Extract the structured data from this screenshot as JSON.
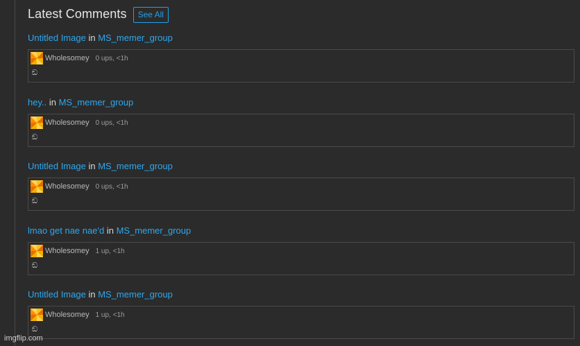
{
  "header": {
    "title": "Latest Comments",
    "see_all_label": "See All"
  },
  "comments": [
    {
      "post_title": "Untitled Image",
      "in_word": "in",
      "group_name": "MS_memer_group",
      "username": "Wholesomey",
      "stats": "0 ups, <1h",
      "text": "ඞ"
    },
    {
      "post_title": "hey..",
      "in_word": "in",
      "group_name": "MS_memer_group",
      "username": "Wholesomey",
      "stats": "0 ups, <1h",
      "text": "ඞ"
    },
    {
      "post_title": "Untitled Image",
      "in_word": "in",
      "group_name": "MS_memer_group",
      "username": "Wholesomey",
      "stats": "0 ups, <1h",
      "text": "ඞ"
    },
    {
      "post_title": "lmao get nae nae'd",
      "in_word": "in",
      "group_name": "MS_memer_group",
      "username": "Wholesomey",
      "stats": "1 up, <1h",
      "text": "ඞ"
    },
    {
      "post_title": "Untitled Image",
      "in_word": "in",
      "group_name": "MS_memer_group",
      "username": "Wholesomey",
      "stats": "1 up, <1h",
      "text": "ඞ"
    }
  ],
  "watermark": {
    "text": "imgflip.com"
  },
  "colors": {
    "background": "#2b2b2b",
    "link": "#2ea8ee",
    "button_border": "#1fa3e8",
    "box_border": "#4b4b4b"
  },
  "icons": {
    "avatar": "avatar-pinwheel-icon"
  }
}
